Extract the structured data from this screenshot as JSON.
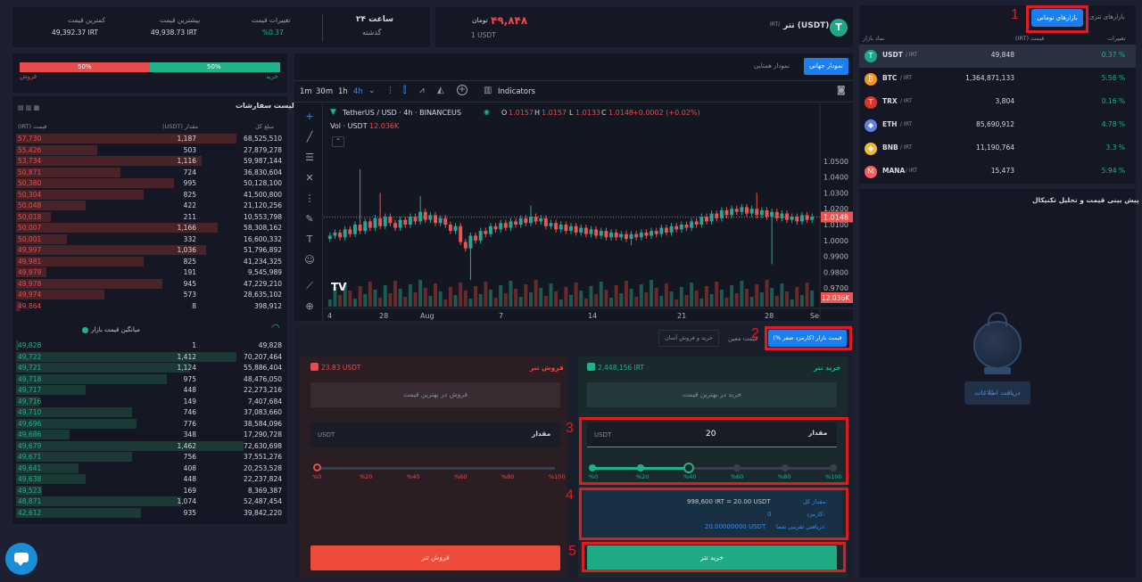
{
  "colors": {
    "bg": "#1c2030",
    "panel": "#151824",
    "buy": "#1fb389",
    "sell": "#e84c4c",
    "accent": "#1a7ff0",
    "annotation": "#e01b24"
  },
  "header": {
    "pair_name": "تتر (USDT)",
    "pair_quote": "IRT/",
    "price": "۴۹,۸۴۸",
    "price_unit": "تومان",
    "price_sub": "1 USDT",
    "period_label": "۲۴ ساعت",
    "period_sub": "گذشته",
    "stats": [
      {
        "label": "تغییرات قیمت",
        "value": "%0.37"
      },
      {
        "label": "بیشترین قیمت",
        "value": "49,938.73 IRT"
      },
      {
        "label": "کمترین قیمت",
        "value": "49,392.37 IRT"
      }
    ]
  },
  "markets": {
    "tab_spot": "بازارهای تومانی",
    "tab_usdt": "بازارهای تتری",
    "col_name": "نماد بازار",
    "col_price": "(IRT) قیمت",
    "col_change": "تغییرات",
    "rows": [
      {
        "symbol": "USDT",
        "quote": "/ IRT",
        "price": "49,848",
        "change": "0.37 %",
        "color": "#1fa985",
        "letter": "T"
      },
      {
        "symbol": "BTC",
        "quote": "/ IRT",
        "price": "1,364,871,133",
        "change": "5.56 %",
        "color": "#f7931a",
        "letter": "₿"
      },
      {
        "symbol": "TRX",
        "quote": "/ IRT",
        "price": "3,804",
        "change": "0.16 %",
        "color": "#d7342a",
        "letter": "T"
      },
      {
        "symbol": "ETH",
        "quote": "/ IRT",
        "price": "85,690,912",
        "change": "4.78 %",
        "color": "#627eea",
        "letter": "◆"
      },
      {
        "symbol": "BNB",
        "quote": "/ IRT",
        "price": "11,190,764",
        "change": "3.3 %",
        "color": "#f3ba2f",
        "letter": "◆"
      },
      {
        "symbol": "MANA",
        "quote": "/ IRT",
        "price": "15,473",
        "change": "5.94 %",
        "color": "#ff5a5f",
        "letter": "M"
      }
    ]
  },
  "analysis": {
    "title": "پیش بینی قیمت و تحلیل تکنیکال",
    "button": "دریافت اطلاعات"
  },
  "ratio": {
    "buy_pct": "50%",
    "sell_pct": "50%",
    "buy_label": "خرید",
    "sell_label": "فروش",
    "buy_fraction": 0.5
  },
  "orderbook": {
    "title": "لیست سفارشات",
    "col_total": "مبلغ کل",
    "col_amount": "(USDT) مقدار",
    "col_price": "(IRT) قیمت",
    "asks": [
      {
        "total": "68,525,510",
        "amount": "1,187",
        "price": "57,730",
        "depth": 0.95
      },
      {
        "total": "27,879,278",
        "amount": "503",
        "price": "55,426",
        "depth": 0.35
      },
      {
        "total": "59,987,144",
        "amount": "1,116",
        "price": "53,734",
        "depth": 0.8
      },
      {
        "total": "36,830,604",
        "amount": "724",
        "price": "50,871",
        "depth": 0.45
      },
      {
        "total": "50,128,100",
        "amount": "995",
        "price": "50,380",
        "depth": 0.68
      },
      {
        "total": "41,500,800",
        "amount": "825",
        "price": "50,304",
        "depth": 0.55
      },
      {
        "total": "21,120,256",
        "amount": "422",
        "price": "50,048",
        "depth": 0.3
      },
      {
        "total": "10,553,798",
        "amount": "211",
        "price": "50,018",
        "depth": 0.15
      },
      {
        "total": "58,308,162",
        "amount": "1,166",
        "price": "50,007",
        "depth": 0.87
      },
      {
        "total": "16,600,332",
        "amount": "332",
        "price": "50,001",
        "depth": 0.22
      },
      {
        "total": "51,796,892",
        "amount": "1,036",
        "price": "49,997",
        "depth": 0.82
      },
      {
        "total": "41,234,325",
        "amount": "825",
        "price": "49,981",
        "depth": 0.55
      },
      {
        "total": "9,545,989",
        "amount": "191",
        "price": "49,979",
        "depth": 0.13
      },
      {
        "total": "47,229,210",
        "amount": "945",
        "price": "49,978",
        "depth": 0.63
      },
      {
        "total": "28,635,102",
        "amount": "573",
        "price": "49,974",
        "depth": 0.38
      },
      {
        "total": "398,912",
        "amount": "8",
        "price": "49,864",
        "depth": 0.02
      }
    ],
    "mid_label": "میانگین قیمت بازار",
    "bids": [
      {
        "total": "49,828",
        "amount": "1",
        "price": "49,828",
        "depth": 0.01
      },
      {
        "total": "70,207,464",
        "amount": "1,412",
        "price": "49,722",
        "depth": 0.95
      },
      {
        "total": "55,886,404",
        "amount": "1,124",
        "price": "49,721",
        "depth": 0.75
      },
      {
        "total": "48,476,050",
        "amount": "975",
        "price": "49,718",
        "depth": 0.65
      },
      {
        "total": "22,273,216",
        "amount": "448",
        "price": "49,717",
        "depth": 0.3
      },
      {
        "total": "7,407,684",
        "amount": "149",
        "price": "49,716",
        "depth": 0.1
      },
      {
        "total": "37,083,660",
        "amount": "746",
        "price": "49,710",
        "depth": 0.5
      },
      {
        "total": "38,584,096",
        "amount": "776",
        "price": "49,696",
        "depth": 0.52
      },
      {
        "total": "17,290,728",
        "amount": "348",
        "price": "49,686",
        "depth": 0.23
      },
      {
        "total": "72,630,698",
        "amount": "1,462",
        "price": "49,679",
        "depth": 0.98
      },
      {
        "total": "37,551,276",
        "amount": "756",
        "price": "49,671",
        "depth": 0.5
      },
      {
        "total": "20,253,528",
        "amount": "408",
        "price": "49,641",
        "depth": 0.27
      },
      {
        "total": "22,237,824",
        "amount": "448",
        "price": "49,638",
        "depth": 0.3
      },
      {
        "total": "8,369,387",
        "amount": "169",
        "price": "49,523",
        "depth": 0.11
      },
      {
        "total": "52,487,454",
        "amount": "1,074",
        "price": "48,871",
        "depth": 0.71
      },
      {
        "total": "39,842,220",
        "amount": "935",
        "price": "42,612",
        "depth": 0.54
      }
    ]
  },
  "chart": {
    "tab_global": "نمودار جهانی",
    "tab_other": "نمودار همتایی",
    "intervals": [
      "1m",
      "30m",
      "1h",
      "4h"
    ],
    "indicators_label": "Indicators",
    "symbol_title": "TetherUS / USD · 4h · BINANCEUS",
    "ohlc": {
      "o": "1.0157",
      "h": "1.0157",
      "l": "1.0133",
      "c": "1.0148",
      "chg": "+0.0002 (+0.02%)"
    },
    "vol_label": "Vol · USDT",
    "vol_value": "12.036K",
    "price_ticks": [
      "1.0500",
      "1.0400",
      "1.0300",
      "1.0200",
      "1.0100",
      "1.0000",
      "0.9900",
      "0.9800",
      "0.9700"
    ],
    "last_price": "1.0148",
    "last_vol": "12.036K",
    "x_ticks": [
      "4",
      "28",
      "Aug",
      "7",
      "14",
      "21",
      "28",
      "Se"
    ]
  },
  "chart_data": {
    "type": "candlestick",
    "title": "TetherUS / USD · 4h · BINANCEUS",
    "ylim": [
      0.965,
      1.055
    ],
    "x": [
      "4",
      "28",
      "Aug",
      "7",
      "14",
      "21",
      "28",
      "Se"
    ],
    "series": [
      {
        "name": "Vol · USDT",
        "last": "12.036K"
      }
    ],
    "closes": [
      1.003,
      1.005,
      1.002,
      1.007,
      1.004,
      1.01,
      1.006,
      1.012,
      1.008,
      1.014,
      1.009,
      1.015,
      1.011,
      1.008,
      1.013,
      1.01,
      1.015,
      1.012,
      1.018,
      1.013,
      1.016,
      1.011,
      1.014,
      1.01,
      1.006,
      1.009,
      0.999,
      0.995,
      1.003,
      1.0,
      1.006,
      1.004,
      1.009,
      1.007,
      1.011,
      1.008,
      1.012,
      1.01,
      1.014,
      1.011,
      1.015,
      1.012,
      1.014,
      1.009,
      1.011,
      1.007,
      1.01,
      1.006,
      1.009,
      1.005,
      1.008,
      1.004,
      1.007,
      1.003,
      1.006,
      1.002,
      1.005,
      1.002,
      1.004,
      1.001,
      1.004,
      1.002,
      1.005,
      1.003,
      1.006,
      1.004,
      1.008,
      1.005,
      1.009,
      1.007,
      1.01,
      1.008,
      1.012,
      1.01,
      1.015,
      1.012,
      1.017,
      1.014,
      1.019,
      1.016,
      1.02,
      1.018,
      1.021,
      1.017,
      1.02,
      1.016,
      1.019,
      1.015,
      1.018,
      1.014,
      1.017,
      1.013,
      1.015,
      1.012,
      1.016,
      1.013,
      1.015
    ]
  },
  "order_form": {
    "tabs": [
      "قیمت بازار (کارمزد صفر %)",
      "قیمت معین",
      "خرید و فروش آسان"
    ],
    "buy": {
      "title": "خرید تتر",
      "balance": "2,448,156 IRT",
      "best_price": "خرید در بهترین قیمت",
      "amount_label": "مقدار",
      "amount_value": "20",
      "unit": "USDT",
      "slider_marks": [
        "%0",
        "%20",
        "%40",
        "%60",
        "%80",
        "%100"
      ],
      "slider_value": 0.4,
      "summary_total_label": "مقدار کل:",
      "summary_total_value": "998,600 IRT = 20.00 USDT",
      "summary_fee_label": "کارمزد:",
      "summary_fee_value": "0",
      "summary_receive_label": "دریافتی تقریبی شما:",
      "summary_receive_value": "20.00000000 USDT",
      "submit": "خرید تتر"
    },
    "sell": {
      "title": "فروش تتر",
      "balance": "23.83 USDT",
      "best_price": "فروش در بهترین قیمت",
      "amount_label": "مقدار",
      "unit": "USDT",
      "slider_marks": [
        "%0",
        "%20",
        "%40",
        "%60",
        "%80",
        "%100"
      ],
      "slider_value": 0,
      "submit": "فروش تتر"
    }
  },
  "annotations": [
    "1",
    "2",
    "3",
    "4",
    "5"
  ]
}
